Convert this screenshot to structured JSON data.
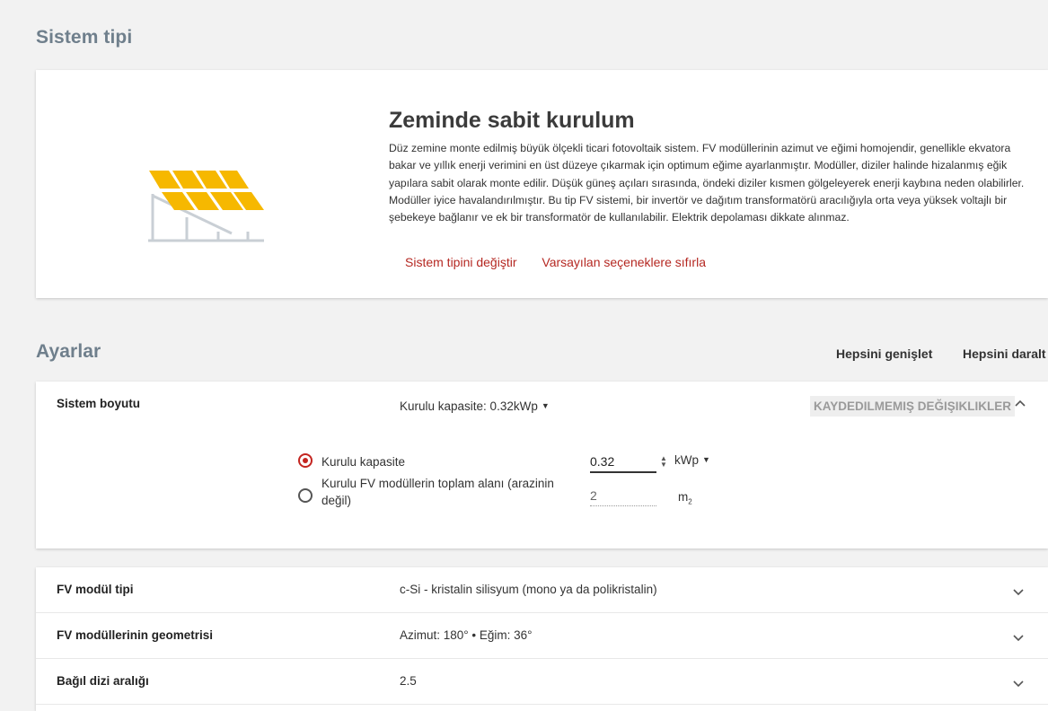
{
  "system_type": {
    "section_title": "Sistem tipi",
    "name": "Zeminde sabit kurulum",
    "description": "Düz zemine monte edilmiş büyük ölçekli ticari fotovoltaik sistem. FV modüllerinin azimut ve eğimi homojendir, genellikle ekvatora bakar ve yıllık enerji verimini en üst düzeye çıkarmak için optimum eğime ayarlanmıştır. Modüller, diziler halinde hizalanmış eğik yapılara sabit olarak monte edilir. Düşük güneş açıları sırasında, öndeki diziler kısmen gölgeleyerek enerji kaybına neden olabilirler. Modüller iyice havalandırılmıştır. Bu tip FV sistemi, bir invertör ve dağıtım transformatörü aracılığıyla orta veya yüksek voltajlı bir şebekeye bağlanır ve ek bir transformatör de kullanılabilir. Elektrik depolaması dikkate alınmaz.",
    "change_link": "Sistem tipini değiştir",
    "reset_link": "Varsayılan seçeneklere sıfırla",
    "icon": "solar-panel-icon"
  },
  "settings": {
    "section_title": "Ayarlar",
    "expand_all": "Hepsini genişlet",
    "collapse_all": "Hepsini daralt"
  },
  "system_size": {
    "label": "Sistem boyutu",
    "summary": "Kurulu kapasite: 0.32kWp",
    "unsaved_badge": "KAYDEDILMEMIŞ DEĞIŞIKLIKLER",
    "option_capacity": "Kurulu kapasite",
    "option_area_line1": "Kurulu FV modüllerin toplam alanı (arazinin",
    "option_area_line2": "değil)",
    "capacity_value": "0.32",
    "capacity_unit": "kWp",
    "area_value": "2",
    "area_unit": "m",
    "area_unit_sup": "2",
    "selected_option": "capacity"
  },
  "rows": [
    {
      "label": "FV modül tipi",
      "value": "c-Si - kristalin silisyum (mono ya da polikristalin)"
    },
    {
      "label": "FV modüllerinin geometrisi",
      "value": "Azimut: 180° • Eğim: 36°"
    },
    {
      "label": "Bağıl dizi aralığı",
      "value": "2.5"
    }
  ],
  "colors": {
    "accent_red": "#c42520",
    "panel_yellow": "#f6b800",
    "panel_frame": "#c9cfd5"
  }
}
